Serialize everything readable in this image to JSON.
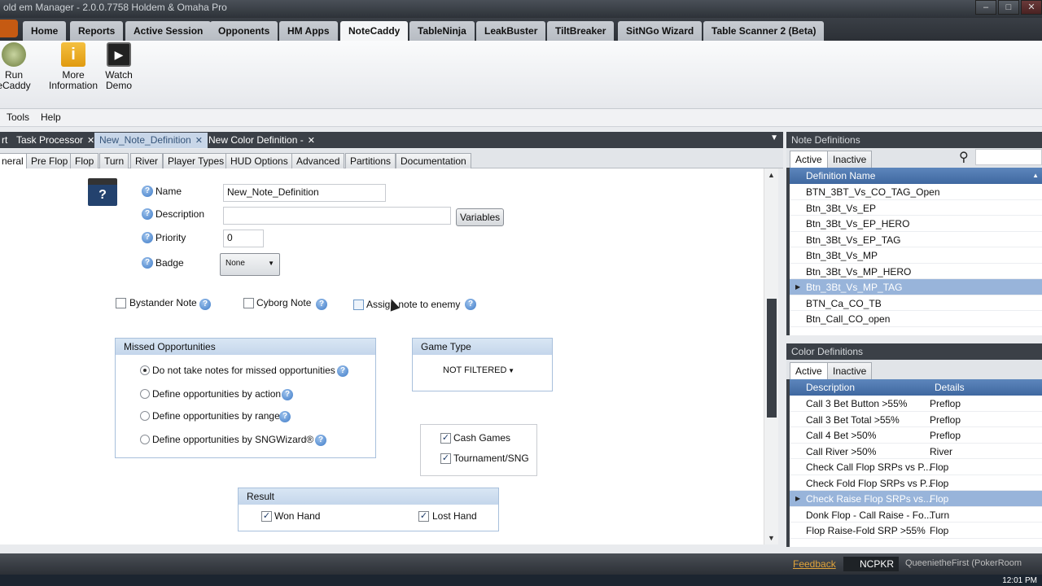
{
  "window": {
    "title": "old em Manager - 2.0.0.7758 Holdem & Omaha Pro"
  },
  "menu": {
    "tabs": [
      "Home",
      "Reports",
      "Active Session",
      "Opponents",
      "HM Apps",
      "NoteCaddy",
      "TableNinja",
      "LeakBuster",
      "TiltBreaker",
      "SitNGo Wizard",
      "Table Scanner 2 (Beta)"
    ],
    "active": "NoteCaddy"
  },
  "ribbon": {
    "run_label": "Run\neCaddy",
    "more_info_label": "More\nInformation",
    "watch_demo_label": "Watch\nDemo"
  },
  "submenu": {
    "tools": "Tools",
    "help": "Help"
  },
  "doc_tabs": [
    {
      "label": "rt"
    },
    {
      "label": "Task Processor"
    },
    {
      "label": "New_Note_Definition"
    },
    {
      "label": "New Color Definition -"
    }
  ],
  "sub_tabs": [
    "neral",
    "Pre Flop",
    "Flop",
    "Turn",
    "River",
    "Player Types",
    "HUD Options",
    "Advanced",
    "Partitions",
    "Documentation"
  ],
  "form": {
    "name_label": "Name",
    "name_value": "New_Note_Definition",
    "description_label": "Description",
    "description_value": "",
    "variables_button": "Variables",
    "priority_label": "Priority",
    "priority_value": "0",
    "badge_label": "Badge",
    "badge_value": "None",
    "bystander_label": "Bystander Note",
    "cyborg_label": "Cyborg Note",
    "assign_label": "Assign note to enemy",
    "missed_header": "Missed Opportunities",
    "missed_options": [
      "Do not take notes for missed opportunities",
      "Define opportunities by action",
      "Define opportunities by range",
      "Define opportunities by SNGWizard®"
    ],
    "game_type_header": "Game Type",
    "game_type_value": "NOT FILTERED",
    "cash_games_label": "Cash Games",
    "tournament_label": "Tournament/SNG",
    "result_header": "Result",
    "won_hand_label": "Won Hand",
    "lost_hand_label": "Lost Hand"
  },
  "note_definitions": {
    "title": "Note Definitions",
    "tabs": [
      "Active",
      "Inactive"
    ],
    "column": "Definition Name",
    "rows": [
      "BTN_3BT_Vs_CO_TAG_Open",
      "Btn_3Bt_Vs_EP",
      "Btn_3Bt_Vs_EP_HERO",
      "Btn_3Bt_Vs_EP_TAG",
      "Btn_3Bt_Vs_MP",
      "Btn_3Bt_Vs_MP_HERO",
      "Btn_3Bt_Vs_MP_TAG",
      "BTN_Ca_CO_TB",
      "Btn_Call_CO_open"
    ],
    "selected": "Btn_3Bt_Vs_MP_TAG"
  },
  "color_definitions": {
    "title": "Color Definitions",
    "tabs": [
      "Active",
      "Inactive"
    ],
    "columns": [
      "Description",
      "Details"
    ],
    "rows": [
      [
        "Call 3 Bet Button >55%",
        "Preflop"
      ],
      [
        "Call 3 Bet Total >55%",
        "Preflop"
      ],
      [
        "Call 4 Bet >50%",
        "Preflop"
      ],
      [
        "Call River >50%",
        "River"
      ],
      [
        "Check Call Flop SRPs vs P...",
        "Flop"
      ],
      [
        "Check Fold Flop SRPs vs P...",
        "Flop"
      ],
      [
        "Check Raise Flop SRPs  vs...",
        "Flop"
      ],
      [
        "Donk Flop - Call Raise - Fo...",
        "Turn"
      ],
      [
        "Flop Raise-Fold  SRP >55%",
        "Flop"
      ]
    ],
    "selected_index": 6
  },
  "status": {
    "feedback": "Feedback",
    "site": "NCPKR",
    "user": "QueenietheFirst (PokerRoom",
    "clock": "12:01 PM"
  }
}
